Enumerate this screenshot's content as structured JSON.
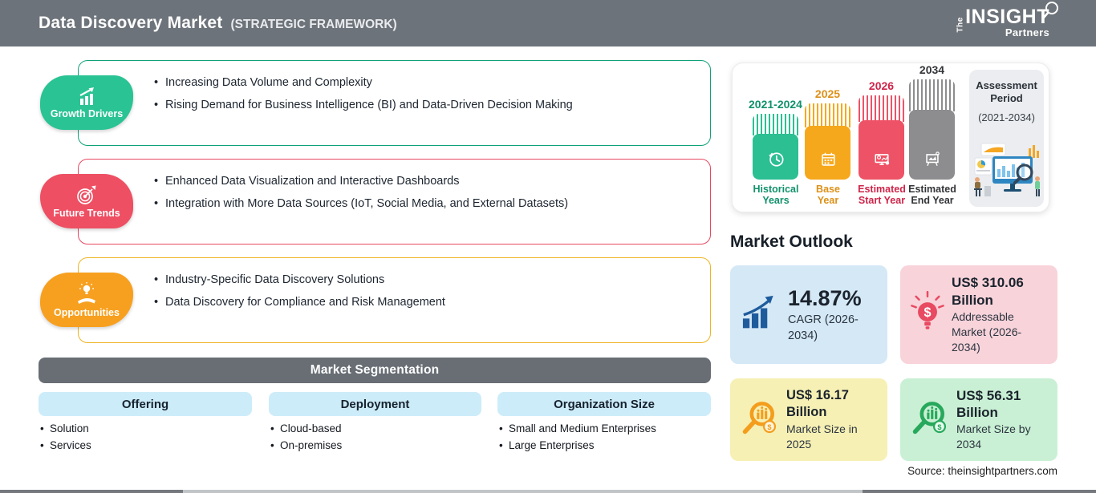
{
  "header": {
    "title": "Data Discovery Market",
    "subtitle": "(STRATEGIC FRAMEWORK)",
    "bg_color": "#6d737a",
    "logo": {
      "the": "The",
      "insight": "INSIGHT",
      "partners": "Partners",
      "icon": "magnifier-icon"
    }
  },
  "drivers": [
    {
      "label": "Growth Drivers",
      "icon": "growth-bars-arrow-icon",
      "badge_color": "#2ac394",
      "border_color": "#0fa178",
      "bullets": [
        "Increasing Data Volume and Complexity",
        "Rising Demand for Business Intelligence (BI) and Data-Driven Decision Making"
      ]
    },
    {
      "label": "Future Trends",
      "icon": "target-arrow-icon",
      "badge_color": "#ee4f63",
      "border_color": "#e8475f",
      "bullets": [
        "Enhanced Data Visualization and Interactive Dashboards",
        "Integration with More Data Sources (IoT, Social Media, and External Datasets)"
      ]
    },
    {
      "label": "Opportunities",
      "icon": "bulb-hand-icon",
      "badge_color": "#f7a01f",
      "border_color": "#eeb422",
      "bullets": [
        "Industry-Specific Data Discovery Solutions",
        "Data Discovery for Compliance and Risk Management"
      ]
    }
  ],
  "segmentation": {
    "title": "Market Segmentation",
    "columns": [
      {
        "label": "Offering",
        "items": [
          "Solution",
          "Services"
        ]
      },
      {
        "label": "Deployment",
        "items": [
          "Cloud-based",
          "On-premises"
        ]
      },
      {
        "label": "Organization Size",
        "items": [
          "Small and Medium Enterprises",
          "Large Enterprises"
        ]
      }
    ]
  },
  "timeline": {
    "bars": [
      {
        "year": "2021-2024",
        "caption": "Historical Years",
        "icon": "history-clock-icon",
        "color": "#2bbf92",
        "text_color": "#12916c"
      },
      {
        "year": "2025",
        "caption": "Base Year",
        "icon": "calendar-icon",
        "color": "#f6a81c",
        "text_color": "#dd9018"
      },
      {
        "year": "2026",
        "caption": "Estimated Start Year",
        "icon": "monitor-chart-icon",
        "color": "#ee5266",
        "text_color": "#cf2449"
      },
      {
        "year": "2034",
        "caption": "Estimated End Year",
        "icon": "presentation-board-icon",
        "color": "#8d8d8f",
        "text_color": "#333538"
      }
    ],
    "assessment": {
      "title": "Assessment Period",
      "range": "(2021-2034)",
      "illustration": "analytics-dashboard-illustration"
    }
  },
  "outlook": {
    "heading": "Market Outlook",
    "cards": [
      {
        "value": "14.87%",
        "caption": "CAGR (2026-2034)",
        "icon": "growth-bars-arrow-icon",
        "bg": "#d4e8f6",
        "icon_color": "#1e5b9c"
      },
      {
        "value": "US$ 310.06 Billion",
        "caption": "Addressable Market (2026-2034)",
        "icon": "bulb-dollar-icon",
        "bg": "#f8d3da",
        "icon_color": "#e84a61"
      },
      {
        "value": "US$ 16.17 Billion",
        "caption": "Market Size in 2025",
        "icon": "magnifier-chart-icon",
        "bg": "#f6f0b4",
        "icon_color": "#f49d1d"
      },
      {
        "value": "US$ 56.31 Billion",
        "caption": "Market Size by 2034",
        "icon": "magnifier-chart-icon",
        "bg": "#c9f0d4",
        "icon_color": "#27a85c"
      }
    ],
    "source": "Source: theinsightpartners.com"
  }
}
